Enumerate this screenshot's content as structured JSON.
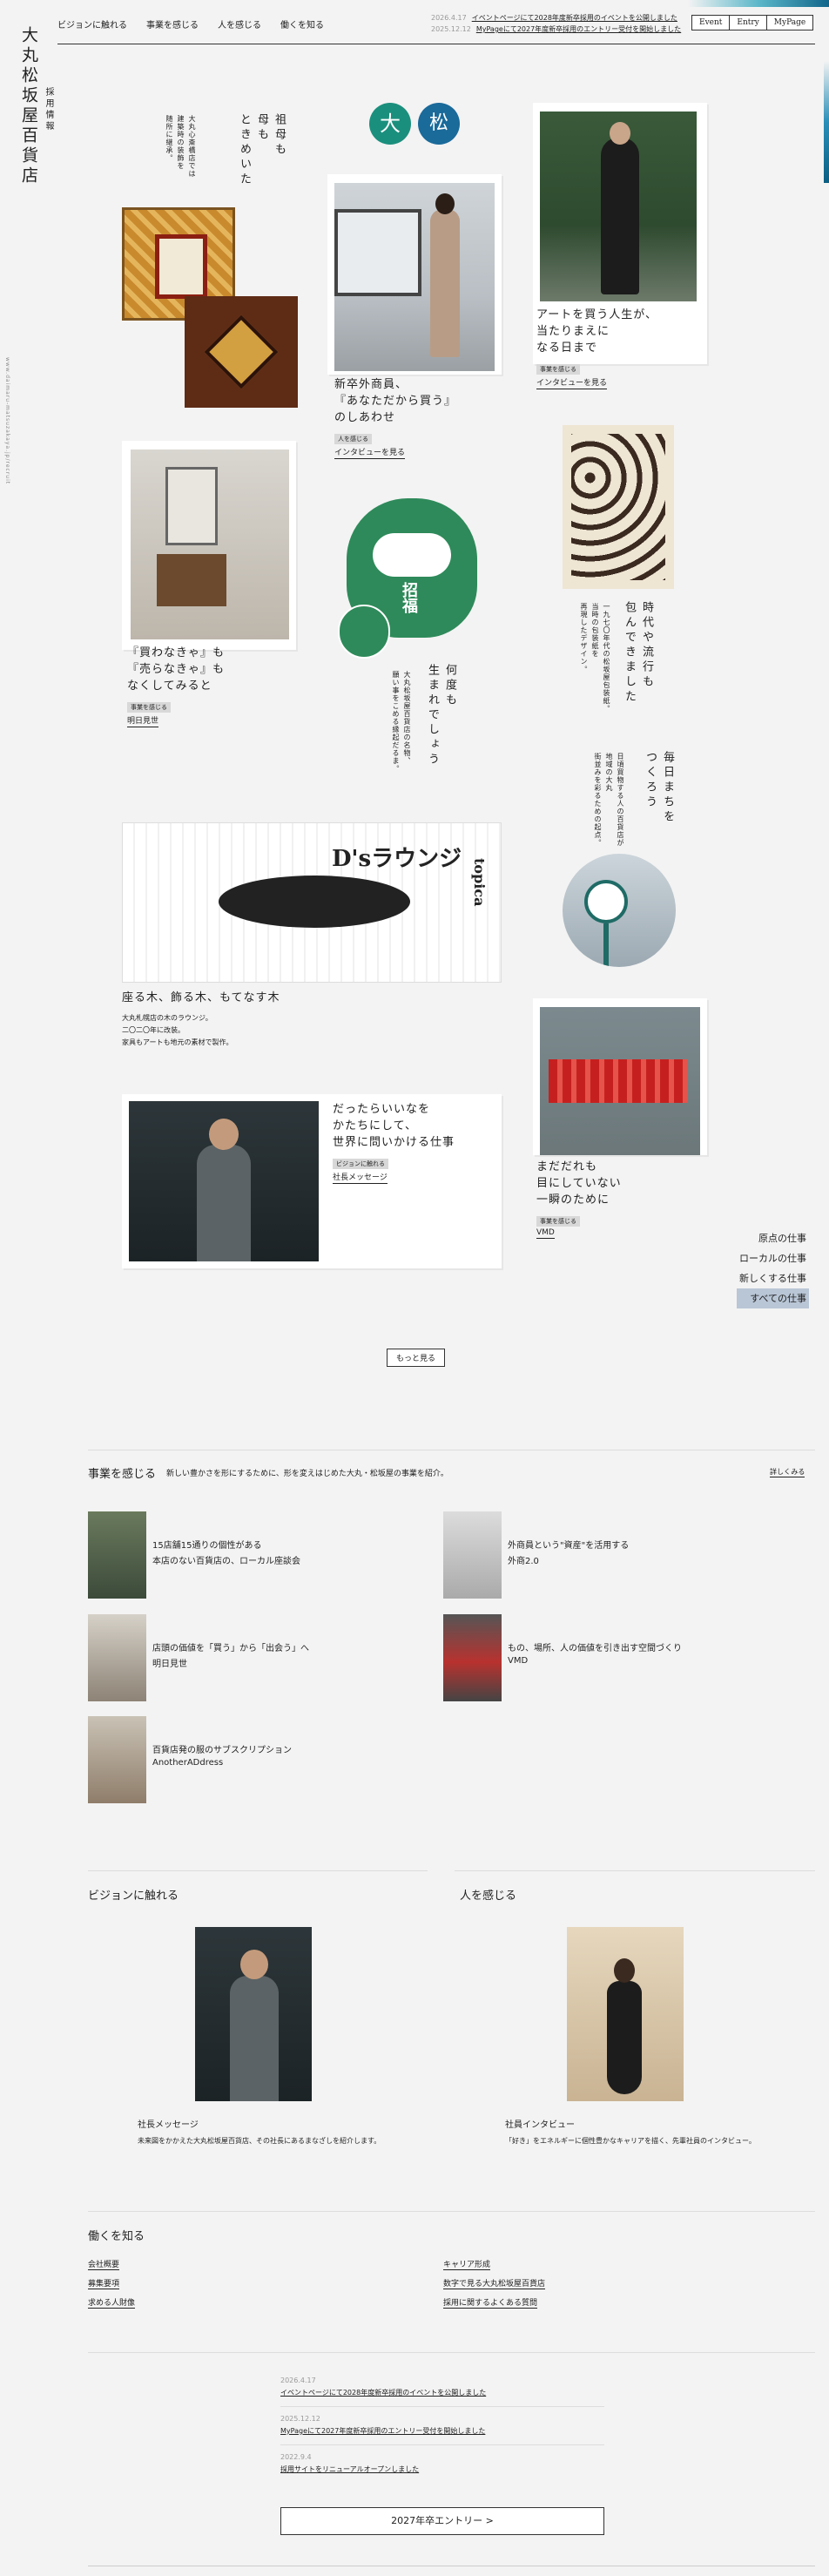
{
  "brand": {
    "logo": "大丸松坂屋百貨店",
    "logo_sub": "採用情報",
    "side_url": "www.daimaru-matsuzakaya.jp/recruit"
  },
  "header": {
    "nav": [
      "ビジョンに触れる",
      "事業を感じる",
      "人を感じる",
      "働くを知る"
    ],
    "news": [
      {
        "date": "2026.4.17",
        "text": "イベントページにて2028年度新卒採用のイベントを公開しました"
      },
      {
        "date": "2025.12.12",
        "text": "MyPageにて2027年度新卒採用のエントリー受付を開始しました"
      }
    ],
    "buttons": [
      "Event",
      "Entry",
      "MyPage"
    ]
  },
  "cards": {
    "grandma": {
      "title": "祖母も\n母も\nときめいた",
      "desc": "大丸心斎橋店では\n建築時の装飾を\n随所に継承。"
    },
    "logos": {
      "a": "大",
      "b": "松"
    },
    "art": {
      "title": "アートを買う人生が、\n当たりまえに\nなる日まで",
      "tag": "事業を感じる",
      "link": "インタビューを見る"
    },
    "newgrad": {
      "title": "新卒外商員、\n『あなただから買う』\nのしあわせ",
      "tag": "人を感じる",
      "link": "インタビューを見る"
    },
    "buy": {
      "title": "『買わなきゃ』も\n『売らなきゃ』も\nなくしてみると",
      "tag": "事業を感じる",
      "link": "明日見世"
    },
    "daruma": {
      "title": "何度も\n生まれでしょう",
      "desc": "大丸松坂屋百貨店の名物、\n願い事をこめる縁起だるま。",
      "text": "招福"
    },
    "era": {
      "title": "時代や流行も\n包んできました",
      "desc": "一九七〇年代の松坂屋包装紙。\n当時の包装紙を\n再現したデザイン。"
    },
    "town": {
      "title": "毎日まちを\nつくろう",
      "desc": "日頃買物する人の百貨店が\n地域の大丸\n街並みを彩るための起点。"
    },
    "lounge": {
      "title": "座る木、飾る木、もてなす木",
      "desc": "大丸札幌店の木のラウンジ。\n二〇二〇年に改装。\n家具もアートも地元の素材で製作。",
      "poster_title": "D'sラウンジ",
      "poster_side": "topica"
    },
    "president": {
      "title": "だったらいいなを\nかたちにして、\n世界に問いかける仕事",
      "tag": "ビジョンに触れる",
      "link": "社長メッセージ"
    },
    "vmd": {
      "title": "まだだれも\n目にしていない\n一瞬のために",
      "tag": "事業を感じる",
      "link": "VMD"
    }
  },
  "filter": [
    "原点の仕事",
    "ローカルの仕事",
    "新しくする仕事",
    "すべての仕事"
  ],
  "more": "もっと見る",
  "business": {
    "title": "事業を感じる",
    "desc": "新しい豊かさを形にするために、形を変えはじめた大丸・松坂屋の事業を紹介。",
    "more": "詳しくみる",
    "items": [
      {
        "line1": "15店舗15通りの個性がある",
        "line2": "本店のない百貨店の、ローカル座談会"
      },
      {
        "line1": "外商員という\"資産\"を活用する",
        "line2": "外商2.0"
      },
      {
        "line1": "店頭の価値を「買う」から「出会う」へ",
        "line2": "明日見世"
      },
      {
        "line1": "もの、場所、人の価値を引き出す空間づくり",
        "line2": "VMD"
      },
      {
        "line1": "百貨店発の服のサブスクリプション",
        "line2": "AnotherADdress"
      }
    ]
  },
  "vision": {
    "title": "ビジョンに触れる",
    "label": "社長メッセージ",
    "desc": "未来図をかかえた大丸松坂屋百貨店、その社長にあるまなざしを紹介します。"
  },
  "people": {
    "title": "人を感じる",
    "label": "社員インタビュー",
    "desc": "「好き」をエネルギーに個性豊かなキャリアを描く、先輩社員のインタビュー。"
  },
  "work": {
    "title": "働くを知る",
    "left": [
      "会社概要",
      "募集要項",
      "求める人財像"
    ],
    "right": [
      "キャリア形成",
      "数字で見る大丸松坂屋百貨店",
      "採用に関するよくある質問"
    ]
  },
  "bottom_news": [
    {
      "date": "2026.4.17",
      "text": "イベントページにて2028年度新卒採用のイベントを公開しました"
    },
    {
      "date": "2025.12.12",
      "text": "MyPageにて2027年度新卒採用のエントリー受付を開始しました"
    },
    {
      "date": "2022.9.4",
      "text": "採用サイトをリニューアルオープンしました"
    }
  ],
  "entry": "2027年卒エントリー",
  "colors": {
    "bg": "#f3f3f3",
    "accent": "#0b5f83",
    "green": "#2e8a5a",
    "tag": "#d8d8d8",
    "filter_on": "#b9c6d6"
  }
}
